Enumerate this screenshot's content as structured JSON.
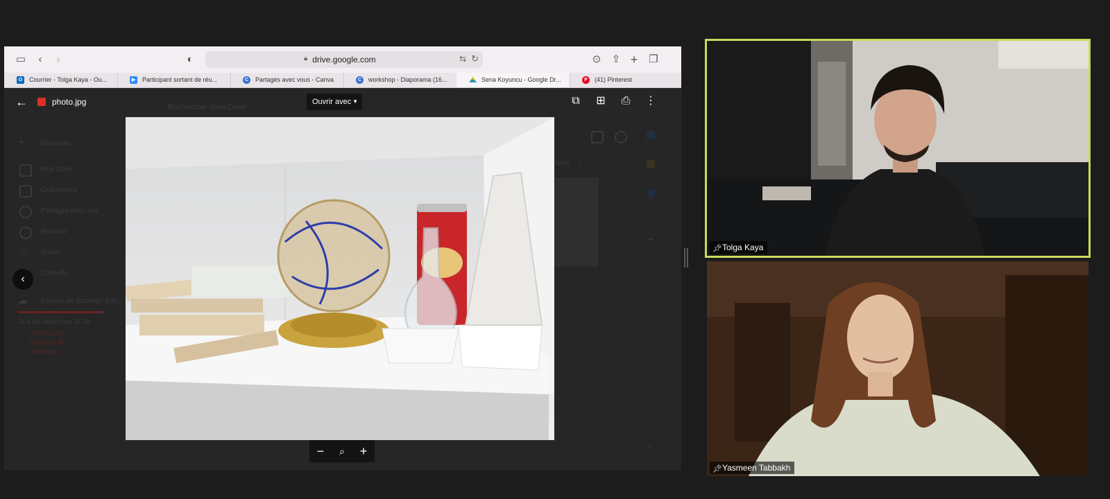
{
  "browser": {
    "url": "drive.google.com",
    "tabs": [
      {
        "label": "Courrier - Tolga Kaya - Ou...",
        "icon": "outlook-icon",
        "color": "#0f6cbd",
        "active": false
      },
      {
        "label": "Participant sortant de réu...",
        "icon": "zoom-icon",
        "color": "#2d8cff",
        "active": false
      },
      {
        "label": "Partagés avec vous - Canva",
        "icon": "canva-icon",
        "color": "#3b6fd4",
        "active": false
      },
      {
        "label": "workshop - Diaporama (16...",
        "icon": "canva-icon",
        "color": "#3b6fd4",
        "active": false
      },
      {
        "label": "Sena Koyuncu - Google Dr...",
        "icon": "google-drive-icon",
        "color": "#1fa463",
        "active": true
      },
      {
        "label": "(41) Pinterest",
        "icon": "pinterest-icon",
        "color": "#e60023",
        "active": false
      }
    ]
  },
  "viewer": {
    "file_name": "photo.jpg",
    "open_with": "Ouvrir avec"
  },
  "drive_background": {
    "search_placeholder": "Rechercher dans Drive",
    "new_button": "Nouveau",
    "nav": [
      "Mon Drive",
      "Ordinateurs",
      "Partagés avec moi",
      "Récents",
      "Suivis",
      "Corbeille"
    ],
    "storage_label": "Espace de stockage (util...",
    "storage_usage": "14,4 Go utilisés sur 15 Go",
    "storage_fraction": 0.96,
    "buy_storage": "Acheter de l'espace de stockage",
    "sort_label": "Nom"
  },
  "participants": [
    {
      "name": "Tolga Kaya",
      "active_speaker": true,
      "highlight_color": "#c8dc5a"
    },
    {
      "name": "Yasmeen Tabbakh",
      "active_speaker": false
    }
  ]
}
